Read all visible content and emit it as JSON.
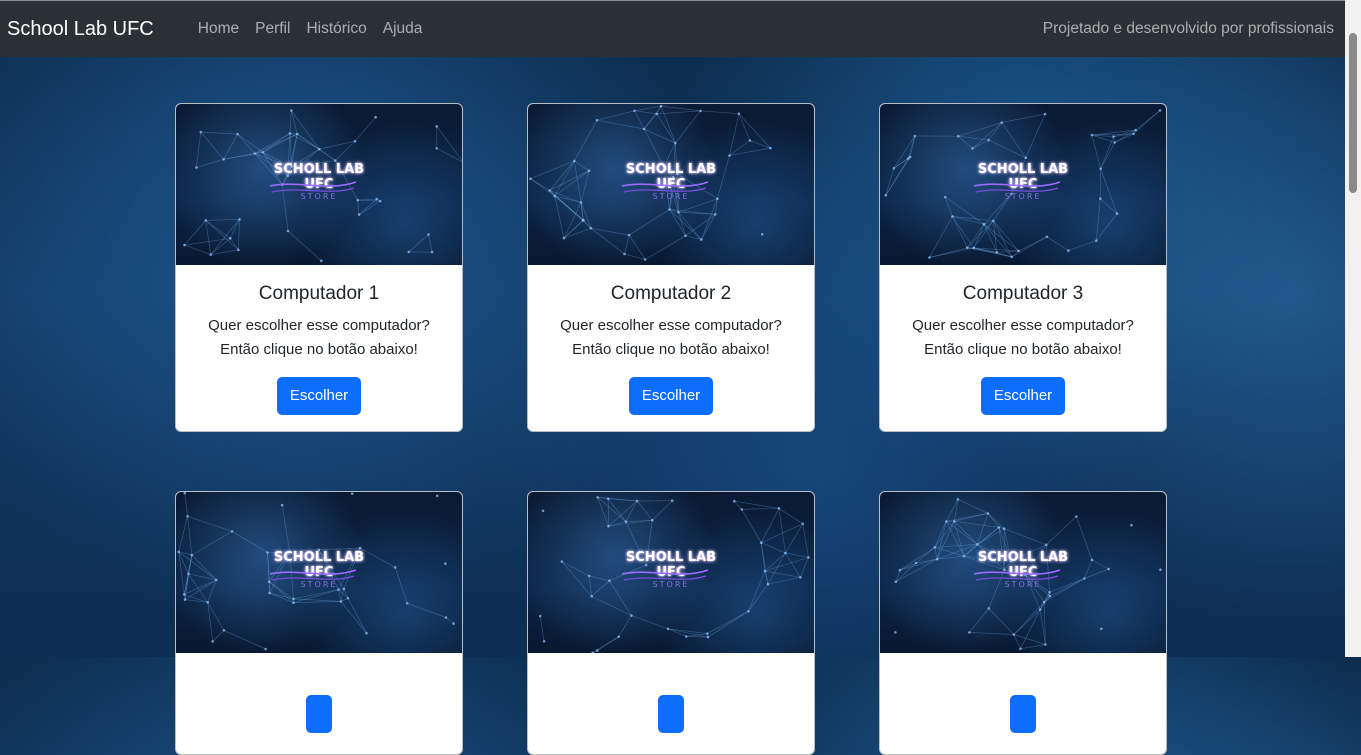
{
  "navbar": {
    "brand": "School Lab UFC",
    "links": [
      "Home",
      "Perfil",
      "Histórico",
      "Ajuda"
    ],
    "right_text": "Projetado e desenvolvido por profissionais"
  },
  "logo": {
    "line1": "SCHOLL LAB",
    "line2": "UFC",
    "line3": "STORE"
  },
  "cards": [
    {
      "title": "Computador 1",
      "text1": "Quer escolher esse computador?",
      "text2": "Então clique no botão abaixo!",
      "button": "Escolher"
    },
    {
      "title": "Computador 2",
      "text1": "Quer escolher esse computador?",
      "text2": "Então clique no botão abaixo!",
      "button": "Escolher"
    },
    {
      "title": "Computador 3",
      "text1": "Quer escolher esse computador?",
      "text2": "Então clique no botão abaixo!",
      "button": "Escolher"
    },
    {
      "title": "",
      "text1": "",
      "text2": "",
      "button": ""
    },
    {
      "title": "",
      "text1": "",
      "text2": "",
      "button": ""
    },
    {
      "title": "",
      "text1": "",
      "text2": "",
      "button": ""
    }
  ],
  "colors": {
    "navbar": "#2b3035",
    "button": "#0d6efd",
    "logo_accent": "#8b6fe0"
  }
}
